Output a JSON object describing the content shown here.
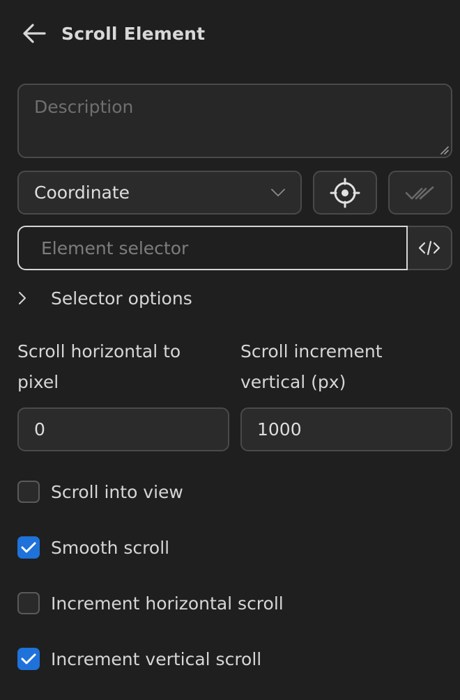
{
  "header": {
    "title": "Scroll Element",
    "back_icon": "arrow-left-icon"
  },
  "description": {
    "placeholder": "Description",
    "value": ""
  },
  "selector_type": {
    "value": "Coordinate",
    "icon": "chevron-down-icon"
  },
  "buttons": {
    "pick_icon": "crosshair-icon",
    "validate_icon": "double-check-icon",
    "code_icon": "code-icon"
  },
  "element_selector": {
    "placeholder": "Element selector",
    "value": ""
  },
  "selector_options": {
    "label": "Selector options",
    "expanded": false
  },
  "scroll_horizontal": {
    "label": "Scroll horizontal to pixel",
    "value": "0"
  },
  "scroll_vertical": {
    "label": "Scroll increment vertical (px)",
    "value": "1000"
  },
  "options": [
    {
      "label": "Scroll into view",
      "checked": false
    },
    {
      "label": "Smooth scroll",
      "checked": true
    },
    {
      "label": "Increment horizontal scroll",
      "checked": false
    },
    {
      "label": "Increment vertical scroll",
      "checked": true
    }
  ],
  "colors": {
    "background": "#1f1f1f",
    "accent": "#1f72d9"
  }
}
